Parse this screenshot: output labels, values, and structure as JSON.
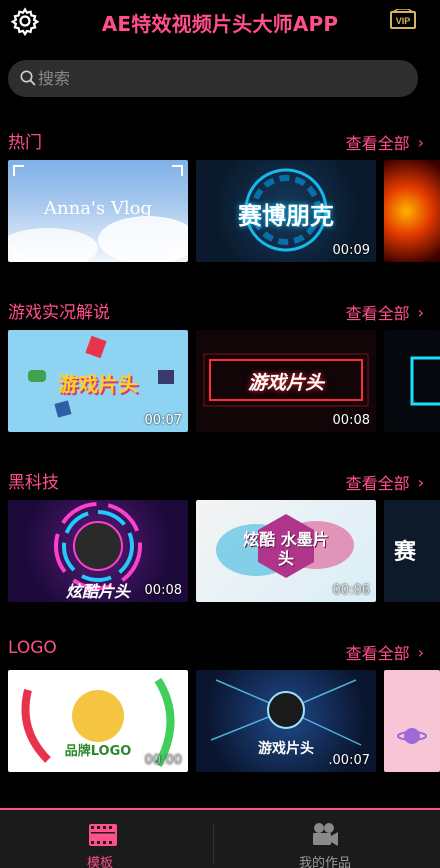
{
  "header": {
    "title": "AE特效视频片头大师APP",
    "settings_icon": "gear-icon",
    "vip_badge": "VIP"
  },
  "search": {
    "placeholder": "搜索"
  },
  "sections": [
    {
      "title": "热门",
      "more": "查看全部",
      "cards": [
        {
          "title": "Anna's Vlog",
          "duration": ""
        },
        {
          "title": "赛博朋克",
          "duration": "00:09"
        },
        {
          "title": "",
          "duration": ""
        }
      ]
    },
    {
      "title": "游戏实况解说",
      "more": "查看全部",
      "cards": [
        {
          "title": "游戏片头",
          "duration": "00:07"
        },
        {
          "title": "游戏片头",
          "duration": "00:08"
        },
        {
          "title": "",
          "duration": ""
        }
      ]
    },
    {
      "title": "黑科技",
      "more": "查看全部",
      "cards": [
        {
          "title": "炫酷片头",
          "duration": "00:08"
        },
        {
          "title": "炫酷 水墨片头",
          "duration": "00:06"
        },
        {
          "title": "赛",
          "duration": ""
        }
      ]
    },
    {
      "title": "LOGO",
      "more": "查看全部",
      "cards": [
        {
          "title": "品牌LOGO",
          "duration": "00:00"
        },
        {
          "title": "游戏片头",
          "duration": ".00:07"
        },
        {
          "title": "",
          "duration": ""
        }
      ]
    }
  ],
  "bottom_nav": {
    "items": [
      {
        "label": "模板",
        "icon": "film-icon",
        "active": true
      },
      {
        "label": "我的作品",
        "icon": "camera-icon",
        "active": false
      }
    ]
  },
  "colors": {
    "accent": "#ff4f8c",
    "background": "#000000",
    "nav_bg": "#1b1b1b",
    "vip_gold": "#d6b45a"
  }
}
